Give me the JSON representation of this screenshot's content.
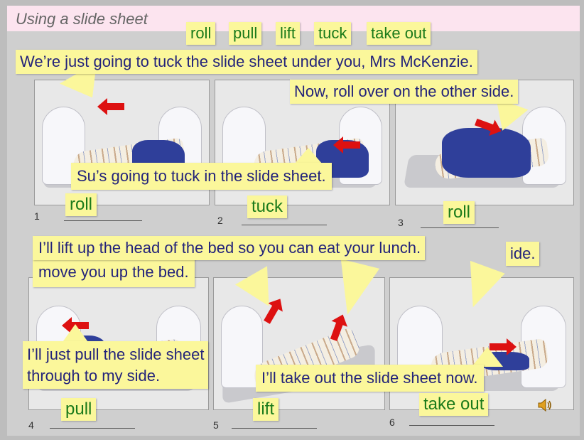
{
  "title": "Using a slide sheet",
  "vocabulary": [
    "roll",
    "pull",
    "lift",
    "tuck",
    "take out"
  ],
  "panels": [
    {
      "number": "1",
      "answer": "roll"
    },
    {
      "number": "2",
      "answer": "tuck"
    },
    {
      "number": "3",
      "answer": "roll"
    },
    {
      "number": "4",
      "answer": "pull"
    },
    {
      "number": "5",
      "answer": "lift"
    },
    {
      "number": "6",
      "answer": "take out"
    }
  ],
  "speech": {
    "tuck_under": "We’re just going to tuck the slide sheet under you, Mrs McKenzie.",
    "roll_over": "Now, roll over on the other side.",
    "su_tuck": "Su’s going to tuck in the slide sheet.",
    "lift_head": "I’ll lift up the head of the bed so you can eat your lunch.",
    "move_up": "move you up the bed.",
    "side_fragment": "ide.",
    "pull_sheet_line1": "I’ll just pull the slide sheet",
    "pull_sheet_line2": "through to my side.",
    "take_out": "I’ll take out the slide sheet now."
  },
  "colors": {
    "note_bg": "#fbf79b",
    "speech_text": "#23237a",
    "answer_text": "#1a7a1a",
    "title_bar": "#fce4ef",
    "sheet": "#2f3f9a",
    "arrow": "#dd1111"
  },
  "icons": {
    "audio": "speaker-icon"
  }
}
